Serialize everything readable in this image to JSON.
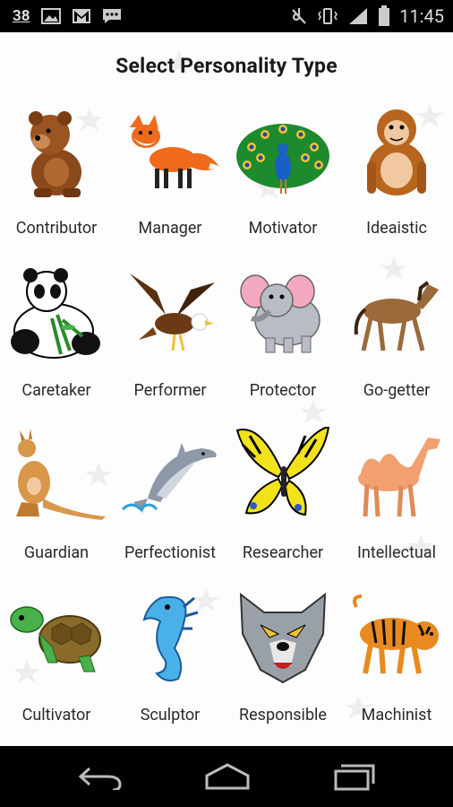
{
  "status_bar": {
    "notification_count": "38",
    "time": "11:45",
    "left_icons": [
      "image-icon",
      "gmail-icon",
      "chat-icon"
    ],
    "right_icons": [
      "mute-icon",
      "vibrate-icon",
      "signal-icon",
      "battery-icon"
    ]
  },
  "page": {
    "title": "Select Personality Type"
  },
  "types": [
    {
      "label": "Contributor",
      "icon": "bear-icon"
    },
    {
      "label": "Manager",
      "icon": "fox-icon"
    },
    {
      "label": "Motivator",
      "icon": "peacock-icon"
    },
    {
      "label": "Ideaistic",
      "icon": "orangutan-icon"
    },
    {
      "label": "Caretaker",
      "icon": "panda-icon"
    },
    {
      "label": "Performer",
      "icon": "eagle-icon"
    },
    {
      "label": "Protector",
      "icon": "elephant-icon"
    },
    {
      "label": "Go-getter",
      "icon": "horse-icon"
    },
    {
      "label": "Guardian",
      "icon": "kangaroo-icon"
    },
    {
      "label": "Perfectionist",
      "icon": "dolphin-icon"
    },
    {
      "label": "Researcher",
      "icon": "butterfly-icon"
    },
    {
      "label": "Intellectual",
      "icon": "camel-icon"
    },
    {
      "label": "Cultivator",
      "icon": "turtle-icon"
    },
    {
      "label": "Sculptor",
      "icon": "seahorse-icon"
    },
    {
      "label": "Responsible",
      "icon": "wolf-icon"
    },
    {
      "label": "Machinist",
      "icon": "tiger-icon"
    }
  ],
  "nav_bar": {
    "buttons": [
      "back-icon",
      "home-icon",
      "recents-icon"
    ]
  }
}
